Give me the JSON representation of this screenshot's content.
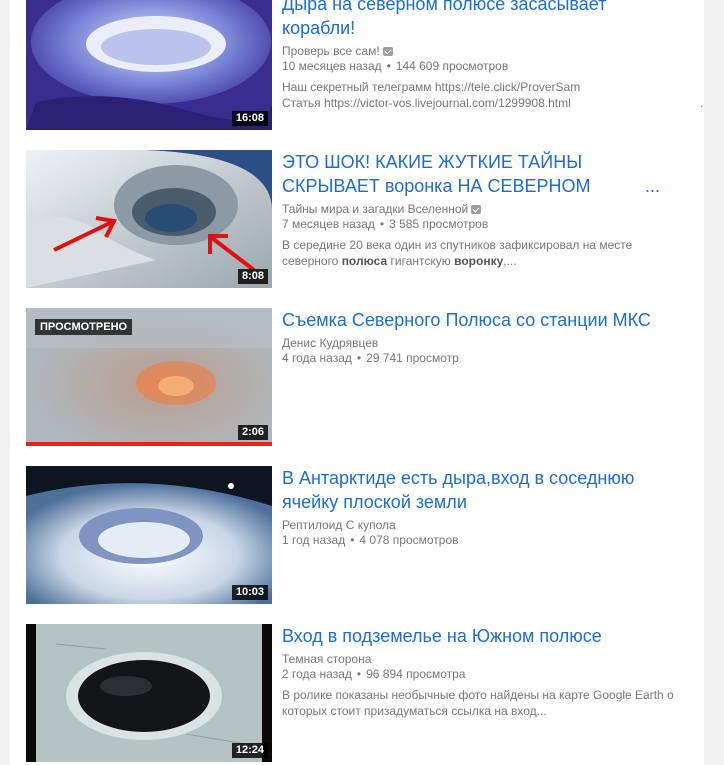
{
  "results": [
    {
      "title_line1": "Дыра на северном полюсе засасывает",
      "title_line2": "корабли!",
      "channel": "Проверь все сам!",
      "verified": true,
      "age": "10 месяцев назад",
      "views": "144 609 просмотров",
      "desc_line1": "Наш секретный телеграмм https://tele.click/ProverSam",
      "desc_line2": "Статья https://victor-vos.livejournal.com/1299908.html",
      "desc_more": "...",
      "duration": "16:08"
    },
    {
      "title_line1": "ЭТО ШОК! КАКИЕ ЖУТКИЕ ТАЙНЫ",
      "title_line2": "СКРЫВАЕТ воронка НА СЕВЕРНОМ",
      "title_ellipsis": "...",
      "channel": "Тайны мира и загадки Вселенной",
      "verified": true,
      "age": "7 месяцев назад",
      "views": "3 585 просмотров",
      "desc_line1": "В середине 20 века один из спутников зафиксировал на месте",
      "desc_line2_a": "северного ",
      "desc_line2_b": "полюса",
      "desc_line2_c": " гигантскую ",
      "desc_line2_d": "воронку",
      "desc_line2_e": ",...",
      "duration": "8:08"
    },
    {
      "title_line1": "Съемка Северного Полюса со станции МКС",
      "channel": "Денис Кудрявцев",
      "age": "4 года назад",
      "views": "29 741 просмотр",
      "badge": "ПРОСМОТРЕНО",
      "watched_progress": 1.0,
      "duration": "2:06"
    },
    {
      "title_line1": "В Антарктиде есть дыра,вход в соседнюю",
      "title_line2": "ячейку плоской земли",
      "channel": "Рептилоид С купола",
      "age": "1 год назад",
      "views": "4 078 просмотров",
      "duration": "10:03"
    },
    {
      "title_line1": "Вход в подземелье на Южном полюсе",
      "channel": "Темная сторона",
      "age": "2 года назад",
      "views": "96 894 просмотра",
      "desc_line1": "В ролике показаны необычные фото найдены на карте Google Earth о",
      "desc_line2": "которых стоит призадуматься ссылка на вход...",
      "duration": "12:24"
    }
  ],
  "separator": "•"
}
